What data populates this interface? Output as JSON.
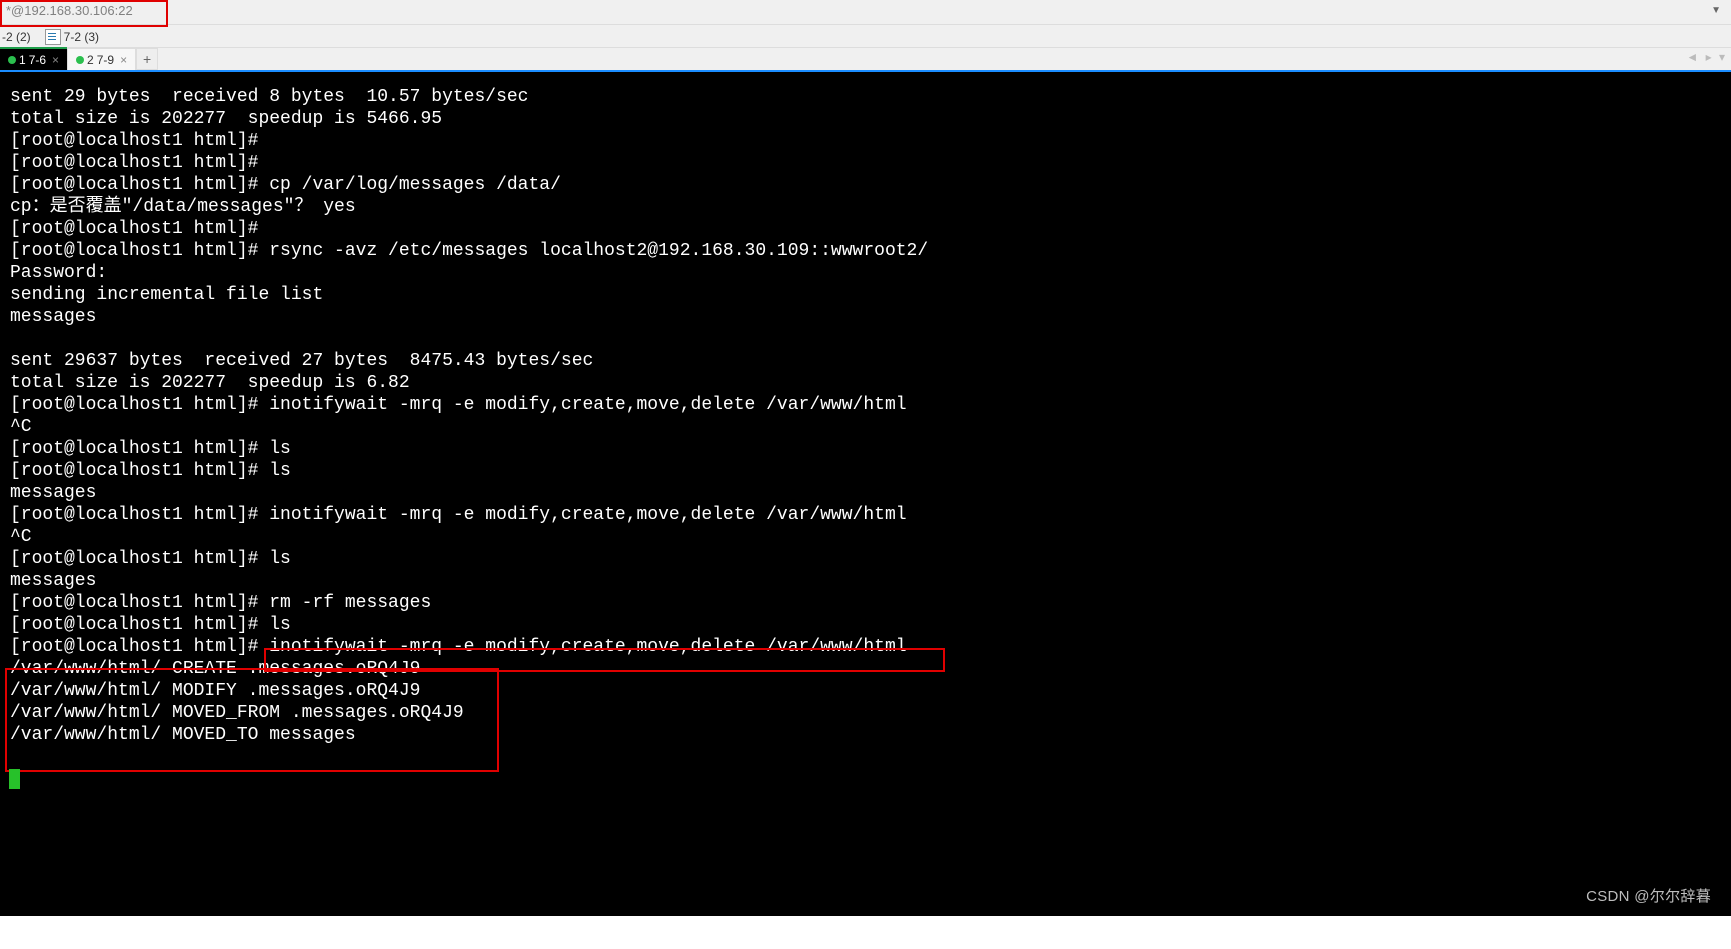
{
  "titlebar": {
    "text": "*@192.168.30.106:22"
  },
  "secondbar": {
    "item1": "-2 (2)",
    "item2": "7-2 (3)"
  },
  "tabs": {
    "t1": {
      "num": "1",
      "label": "7-6",
      "close": "×"
    },
    "t2": {
      "num": "2",
      "label": "7-9",
      "close": "×"
    },
    "add": "+",
    "nav": "◄ ▸ ▾"
  },
  "term": {
    "l01": "sent 29 bytes  received 8 bytes  10.57 bytes/sec",
    "l02": "total size is 202277  speedup is 5466.95",
    "l03": "[root@localhost1 html]#",
    "l04": "[root@localhost1 html]#",
    "l05": "[root@localhost1 html]# cp /var/log/messages /data/",
    "l06": "cp：是否覆盖\"/data/messages\"？ yes",
    "l07": "[root@localhost1 html]#",
    "l08": "[root@localhost1 html]# rsync -avz /etc/messages localhost2@192.168.30.109::wwwroot2/",
    "l09": "Password:",
    "l10": "sending incremental file list",
    "l11": "messages",
    "l12": "",
    "l13": "sent 29637 bytes  received 27 bytes  8475.43 bytes/sec",
    "l14": "total size is 202277  speedup is 6.82",
    "l15": "[root@localhost1 html]# inotifywait -mrq -e modify,create,move,delete /var/www/html",
    "l16": "^C",
    "l17": "[root@localhost1 html]# ls",
    "l18": "[root@localhost1 html]# ls",
    "l19": "messages",
    "l20": "[root@localhost1 html]# inotifywait -mrq -e modify,create,move,delete /var/www/html",
    "l21": "^C",
    "l22": "[root@localhost1 html]# ls",
    "l23": "messages",
    "l24": "[root@localhost1 html]# rm -rf messages",
    "l25": "[root@localhost1 html]# ls",
    "l26": "[root@localhost1 html]# inotifywait -mrq -e modify,create,move,delete /var/www/html",
    "l27": "/var/www/html/ CREATE .messages.oRQ4J9",
    "l28": "/var/www/html/ MODIFY .messages.oRQ4J9",
    "l29": "/var/www/html/ MOVED_FROM .messages.oRQ4J9",
    "l30": "/var/www/html/ MOVED_TO messages"
  },
  "watermark": "CSDN @尔尔辞暮"
}
